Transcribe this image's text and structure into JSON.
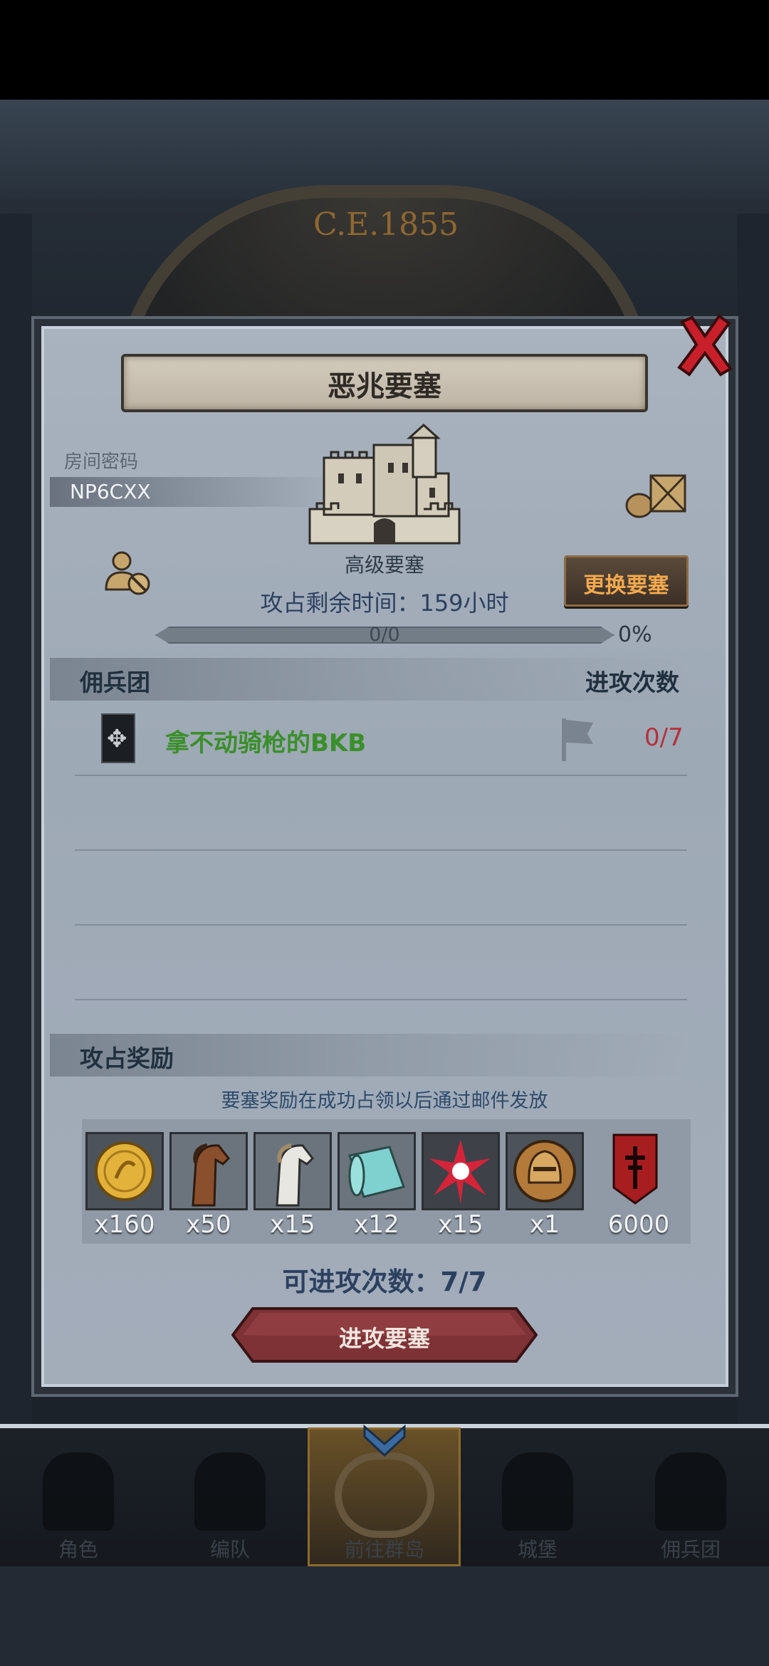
{
  "background": {
    "era_text": "C.E.1855"
  },
  "modal": {
    "title": "恶兆要塞",
    "room_label": "房间密码",
    "room_code": "NP6CXX",
    "fortress_name": "高级要塞",
    "change_button": "更换要塞",
    "time_remaining": "攻占剩余时间：159小时",
    "progress": {
      "text": "0/0",
      "percent_text": "0%",
      "fraction": 0
    },
    "mercenary_section": {
      "title": "佣兵团",
      "right_label": "进攻次数"
    },
    "mercenaries": [
      {
        "name": "拿不动骑枪的BKB",
        "attacks": "0/7"
      }
    ],
    "reward_section": {
      "title": "攻占奖励",
      "note": "要塞奖励在成功占领以后通过邮件发放"
    },
    "rewards": [
      {
        "icon": "gold-coin-icon",
        "qty": "x160"
      },
      {
        "icon": "brown-horse-icon",
        "qty": "x50"
      },
      {
        "icon": "white-horse-icon",
        "qty": "x15"
      },
      {
        "icon": "cloth-roll-icon",
        "qty": "x12"
      },
      {
        "icon": "red-star-burst-icon",
        "qty": "x15"
      },
      {
        "icon": "knight-helmet-icon",
        "qty": "x1"
      },
      {
        "icon": "red-banner-icon",
        "qty": "6000"
      }
    ],
    "attacks_left": "可进攻次数：7/7",
    "attack_button": "进攻要塞"
  },
  "nav": [
    {
      "label": "角色"
    },
    {
      "label": "编队"
    },
    {
      "label": "前往群岛"
    },
    {
      "label": "城堡"
    },
    {
      "label": "佣兵团"
    }
  ],
  "colors": {
    "modal_bg": "#a3adba",
    "accent_orange": "#f2a94d",
    "guild_green": "#3a8f2a",
    "count_red": "#b5303a",
    "close_red": "#c8202a"
  }
}
